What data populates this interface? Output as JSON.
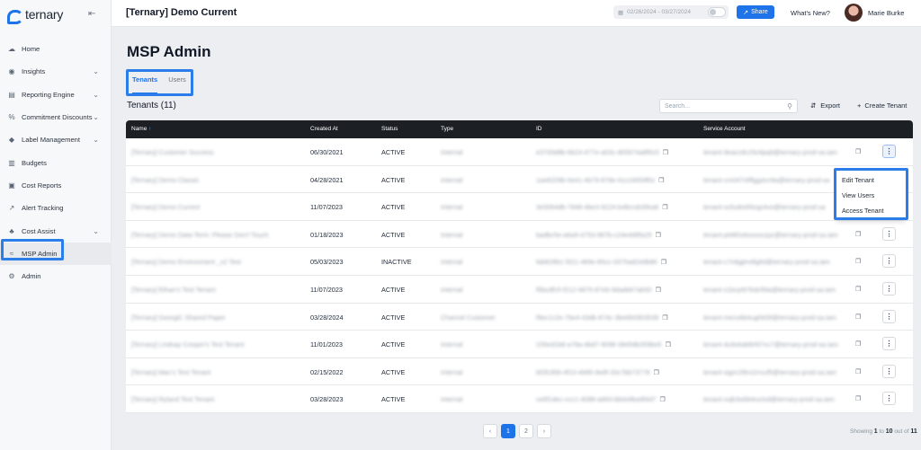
{
  "app": {
    "brand": "ternary",
    "collapse_icon": "collapse-arrow-icon"
  },
  "sidebar": {
    "items": [
      {
        "label": "Home",
        "icon": "cloud-icon",
        "chevron": false,
        "active": false
      },
      {
        "label": "Insights",
        "icon": "lightbulb-icon",
        "chevron": true,
        "active": false
      },
      {
        "label": "Reporting Engine",
        "icon": "bar-chart-icon",
        "chevron": true,
        "active": false
      },
      {
        "label": "Commitment Discounts",
        "icon": "percent-icon",
        "chevron": true,
        "active": false
      },
      {
        "label": "Label Management",
        "icon": "tag-icon",
        "chevron": true,
        "active": false
      },
      {
        "label": "Budgets",
        "icon": "document-icon",
        "chevron": false,
        "active": false
      },
      {
        "label": "Cost Reports",
        "icon": "report-icon",
        "chevron": false,
        "active": false
      },
      {
        "label": "Alert Tracking",
        "icon": "alert-icon",
        "chevron": false,
        "active": false
      },
      {
        "label": "Cost Assist",
        "icon": "assist-icon",
        "chevron": true,
        "active": false
      },
      {
        "label": "MSP Admin",
        "icon": "handshake-icon",
        "chevron": false,
        "active": true
      },
      {
        "label": "Admin",
        "icon": "admin-gears-icon",
        "chevron": false,
        "active": false
      }
    ]
  },
  "header": {
    "title": "[Ternary] Demo Current",
    "date_range": "02/26/2024 - 03/27/2024",
    "share_label": "Share",
    "whats_new_label": "What's New?",
    "user_name": "Marie Burke"
  },
  "main": {
    "page_title": "MSP Admin",
    "tabs": [
      {
        "label": "Tenants",
        "active": true
      },
      {
        "label": "Users",
        "active": false
      }
    ],
    "section_title": "Tenants (11)",
    "search_placeholder": "Search...",
    "export_label": "Export",
    "create_label": "Create Tenant"
  },
  "table": {
    "headers": {
      "name": "Name",
      "created": "Created At",
      "status": "Status",
      "type": "Type",
      "id": "ID",
      "service_account": "Service Account"
    },
    "rows": [
      {
        "name": "[Ternary] Customer Success",
        "created": "06/30/2021",
        "status": "ACTIVE",
        "type": "Internal",
        "id": "e37d3d8b-6b24-477e-a53c-d05974a8f0c5",
        "sa": "tenant-9eacc8c25c6pq9@ternary-prod-sa.iam"
      },
      {
        "name": "[Ternary] Demo Classic",
        "created": "04/28/2021",
        "status": "ACTIVE",
        "type": "Internal",
        "id": "1ae8209b-0e41-4b79-878e-0cc24659f0c",
        "sa": "tenant-cm047r6ffggstvr9a@ternary-prod-sa"
      },
      {
        "name": "[Ternary] Demo Current",
        "created": "11/07/2023",
        "status": "ACTIVE",
        "type": "Internal",
        "id": "3e5064db-7848-4be3-9224-b48ccdc6fea6",
        "sa": "tenant-ss5u8o0f4zgr4vo@ternary-prod-sa"
      },
      {
        "name": "[Ternary] Demo Data-Term: Please Don't Touch",
        "created": "01/18/2023",
        "status": "ACTIVE",
        "type": "Internal",
        "id": "badbc5e-a6a9-4753-987b-c24e4d8fa29",
        "sa": "tenant-pt480s6sosxxzpz@ternary-prod-sa.iam"
      },
      {
        "name": "[Ternary] Demo Environment _v2 Test",
        "created": "05/03/2023",
        "status": "INACTIVE",
        "type": "Internal",
        "id": "fab828b1-f321-469e-85cc-0375ad24db80",
        "sa": "tenant-c7n8gjtrn6lgfsl@ternary-prod-sa.iam"
      },
      {
        "name": "[Ternary] Ethan's Test Tenant",
        "created": "11/07/2023",
        "status": "ACTIVE",
        "type": "Internal",
        "id": "f5bcdfc5-f212-4875-87eb-9dadd47ab50",
        "sa": "tenant-s1bvyt97bdcft9a@ternary-prod-sa.iam"
      },
      {
        "name": "[Ternary] GeorgiC Shared Paper",
        "created": "03/28/2024",
        "status": "ACTIVE",
        "type": "Channel Customer",
        "id": "f9ec1c2e-7be4-43db-874c-3be6b0903539",
        "sa": "tenant-meco6b4ughb5tl@ternary-prod-sa.iam"
      },
      {
        "name": "[Ternary] Lindsay Cooper's Test Tenant",
        "created": "11/01/2023",
        "status": "ACTIVE",
        "type": "Internal",
        "id": "235ed1b8-a78a-4bd7-9098-38458b359be5",
        "sa": "tenant-4u9s6ak8rf47nc7@ternary-prod-sa.iam"
      },
      {
        "name": "[Ternary] Mac's Test Tenant",
        "created": "02/15/2022",
        "status": "ACTIVE",
        "type": "Internal",
        "id": "bf2fc956-4f10-4685-9e8f-33c7bb73778",
        "sa": "tenant-sigm1f6rx2rrcuf5@ternary-prod-sa.iam"
      },
      {
        "name": "[Ternary] Ryland Test Tenant",
        "created": "03/28/2023",
        "status": "ACTIVE",
        "type": "Internal",
        "id": "ce6f1dec-ccc1-4088-a893-bb0e8ba9f4d7",
        "sa": "tenant-sxjb3s6bt4uclxd@ternary-prod-sa.iam"
      }
    ]
  },
  "row_menu": {
    "items": [
      "Edit Tenant",
      "View Users",
      "Access Tenant"
    ]
  },
  "pagination": {
    "pages": [
      "1",
      "2"
    ],
    "current": "1",
    "showing_prefix": "Showing",
    "from": "1",
    "to_word": "to",
    "to": "10",
    "out_of_word": "out of",
    "total": "11"
  },
  "colors": {
    "accent": "#1e73e8",
    "header_dark": "#1c1f24",
    "highlight": "#2b7de9"
  }
}
